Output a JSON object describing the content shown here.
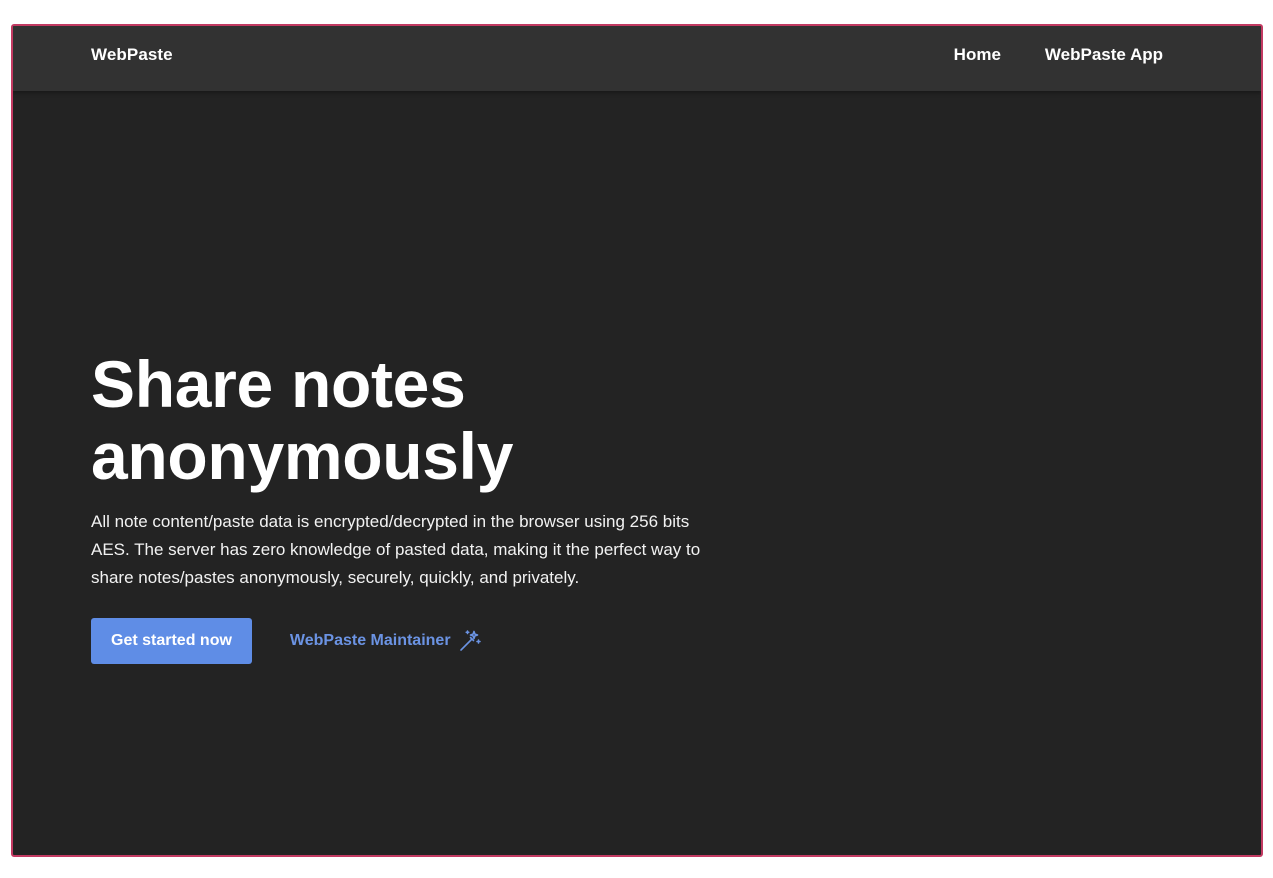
{
  "navbar": {
    "brand": "WebPaste",
    "links": [
      {
        "label": "Home"
      },
      {
        "label": "WebPaste App"
      }
    ]
  },
  "hero": {
    "title_line1": "Share notes",
    "title_line2": "anonymously",
    "description": "All note content/paste data is encrypted/decrypted in the browser using 256 bits AES. The server has zero knowledge of pasted data, making it the perfect way to share notes/pastes anonymously, securely, quickly, and privately.",
    "primary_button": "Get started now",
    "secondary_link": "WebPaste Maintainer",
    "secondary_icon": "magic-wand-icon"
  },
  "colors": {
    "frame_border": "#c23a62",
    "page_background": "#232323",
    "navbar_background": "#323232",
    "accent": "#5f8de6",
    "link": "#6b93e3"
  }
}
